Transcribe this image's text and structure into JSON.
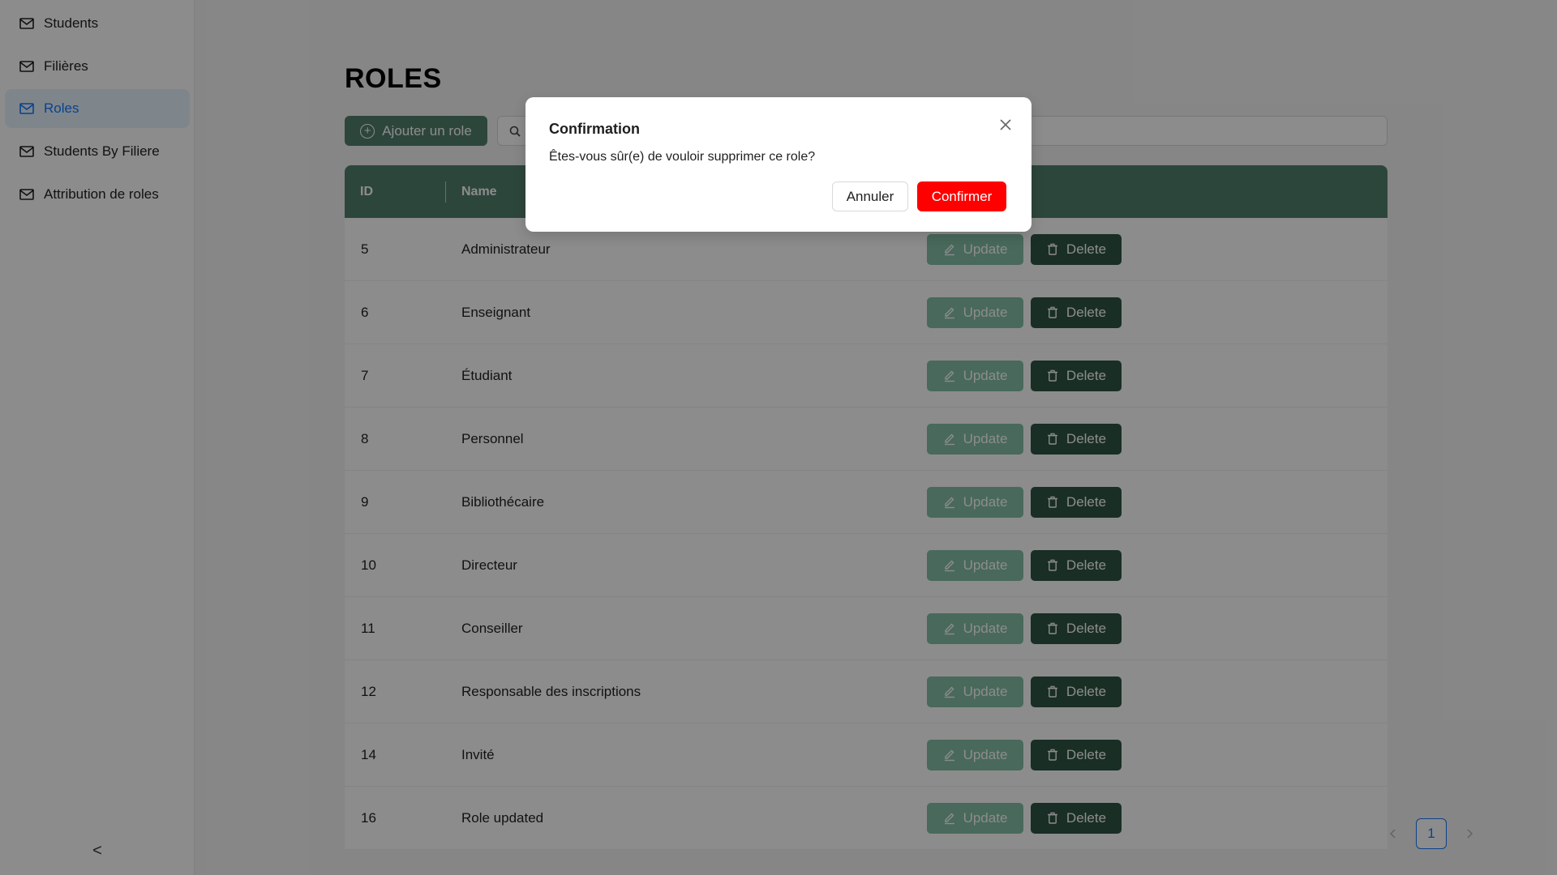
{
  "sidebar": {
    "items": [
      {
        "label": "Students",
        "icon": "mail-icon"
      },
      {
        "label": "Filières",
        "icon": "mail-icon"
      },
      {
        "label": "Roles",
        "icon": "mail-icon",
        "active": true
      },
      {
        "label": "Students By Filiere",
        "icon": "mail-icon"
      },
      {
        "label": "Attribution de roles",
        "icon": "mail-icon"
      }
    ],
    "collapse_glyph": "<"
  },
  "page": {
    "title": "ROLES",
    "add_button_label": "Ajouter un role",
    "search_placeholder": ""
  },
  "table": {
    "columns": [
      "ID",
      "Name"
    ],
    "update_label": "Update",
    "delete_label": "Delete",
    "rows": [
      {
        "id": "5",
        "name": "Administrateur"
      },
      {
        "id": "6",
        "name": "Enseignant"
      },
      {
        "id": "7",
        "name": "Étudiant"
      },
      {
        "id": "8",
        "name": "Personnel"
      },
      {
        "id": "9",
        "name": "Bibliothécaire"
      },
      {
        "id": "10",
        "name": "Directeur"
      },
      {
        "id": "11",
        "name": "Conseiller"
      },
      {
        "id": "12",
        "name": "Responsable des inscriptions"
      },
      {
        "id": "14",
        "name": "Invité"
      },
      {
        "id": "16",
        "name": "Role updated"
      }
    ]
  },
  "pagination": {
    "current_page": "1"
  },
  "modal": {
    "title": "Confirmation",
    "message": "Êtes-vous sûr(e) de vouloir supprimer ce role?",
    "cancel_label": "Annuler",
    "confirm_label": "Confirmer"
  },
  "colors": {
    "primary_green": "#52806d",
    "update_green": "#84bfa6",
    "delete_dark": "#2e5443",
    "confirm_red": "#ff0000",
    "active_blue": "#1677ff"
  }
}
